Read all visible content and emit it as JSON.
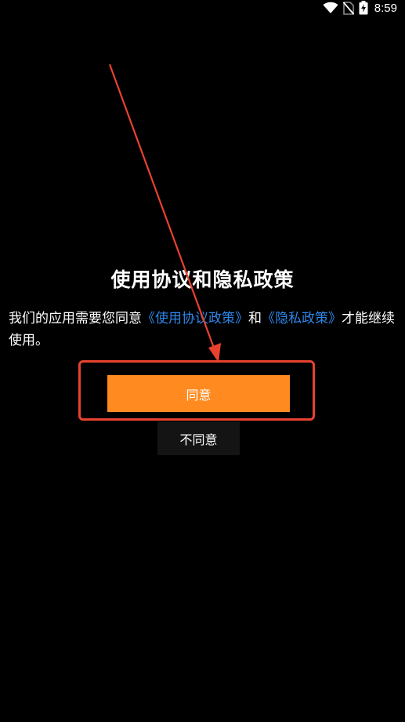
{
  "status_bar": {
    "time": "8:59",
    "icons": [
      "wifi-icon",
      "no-sim-icon",
      "battery-charging-icon"
    ]
  },
  "dialog": {
    "title": "使用协议和隐私政策",
    "message": {
      "part1": "我们的应用需要您同意",
      "link_terms": "《使用协议政策》",
      "part2": "和",
      "link_privacy": "《隐私政策》",
      "part3": "才能继续使用。"
    },
    "agree_label": "同意",
    "disagree_label": "不同意"
  },
  "colors": {
    "background": "#000000",
    "accent": "#ff8a1f",
    "link": "#2e86e8",
    "annotation": "#e8422f"
  }
}
